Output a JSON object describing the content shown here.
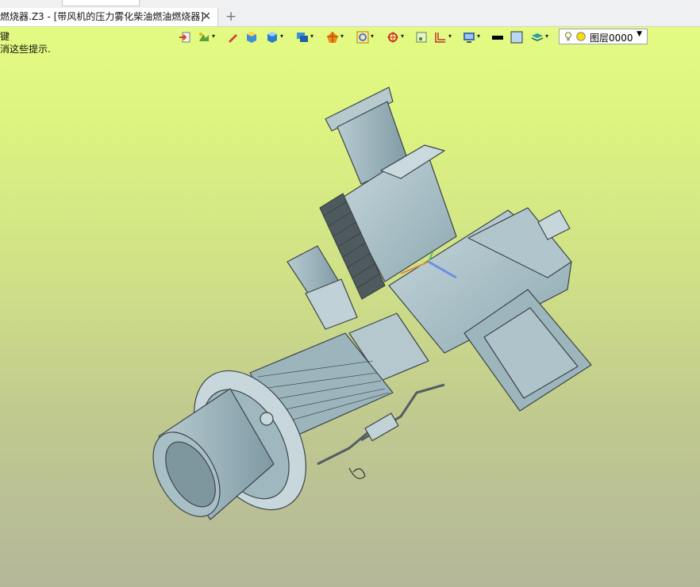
{
  "tab": {
    "title": "燃烧器.Z3 - [带风机的压力雾化柴油燃油燃烧器]",
    "close_glyph": "✕",
    "new_tab_glyph": "+"
  },
  "hint": {
    "line1": "键",
    "line2": "消这些提示."
  },
  "toolbar": {
    "layer": "图层0000"
  },
  "colors": {
    "viewport_top": "#e4fb82",
    "viewport_bottom": "#b4b79a",
    "model_steel": "#a7c0c9",
    "model_edge": "#3b4449"
  }
}
